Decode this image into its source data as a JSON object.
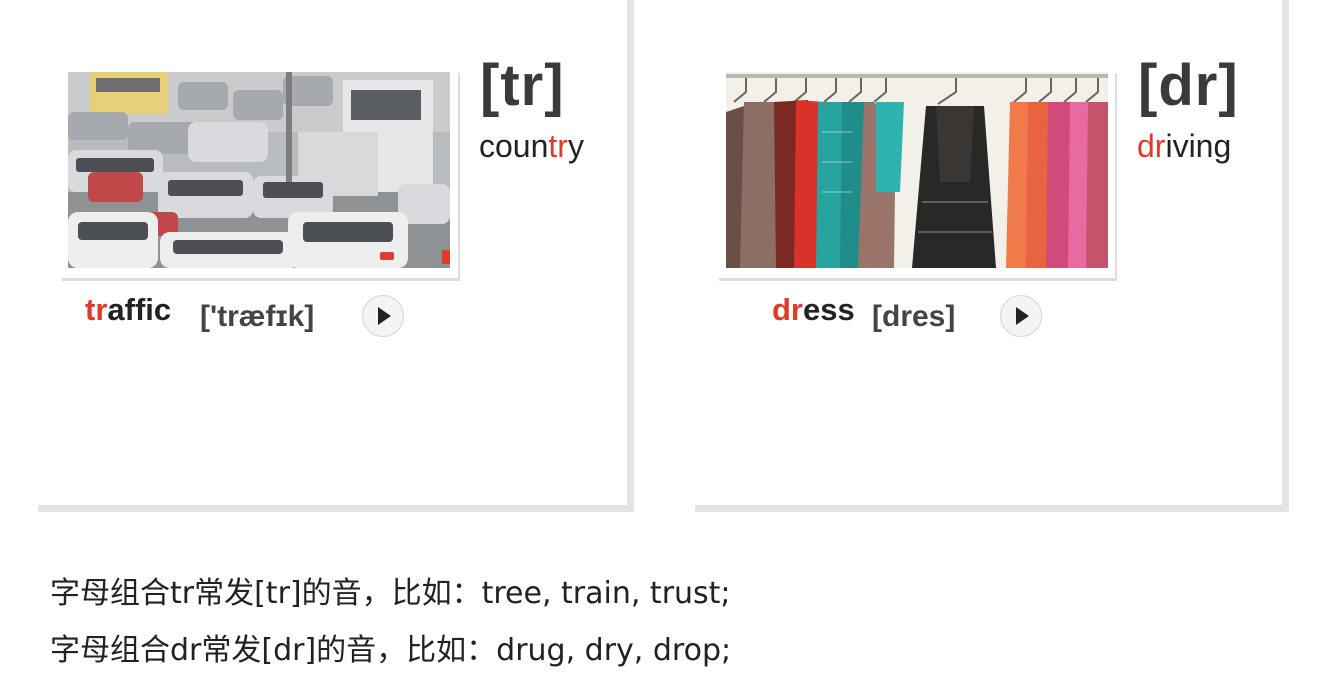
{
  "cards": [
    {
      "phoneme": "[tr]",
      "example_word": {
        "pre": "coun",
        "highlight": "tr",
        "post": "y"
      },
      "image_subject": "traffic-jam",
      "word": {
        "highlight": "tr",
        "rest": "affic"
      },
      "ipa": "['træfɪk]",
      "audio_icon": "play-icon"
    },
    {
      "phoneme": "[dr]",
      "example_word": {
        "pre": "",
        "highlight": "dr",
        "post": "iving"
      },
      "image_subject": "dresses-on-rack",
      "word": {
        "highlight": "dr",
        "rest": "ess"
      },
      "ipa": "[dres]",
      "audio_icon": "play-icon"
    }
  ],
  "notes": [
    "字母组合tr常发[tr]的音，比如：tree, train, trust;",
    "字母组合dr常发[dr]的音，比如：drug, dry, drop;"
  ],
  "colors": {
    "highlight": "#e03a2a",
    "text": "#222222",
    "card_shadow": "#e4e4e4"
  }
}
